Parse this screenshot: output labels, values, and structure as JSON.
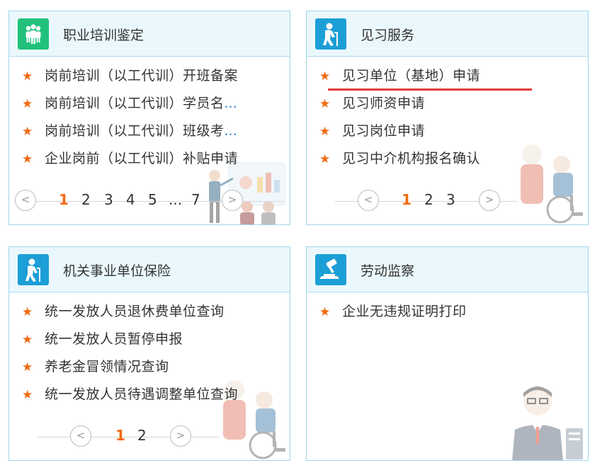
{
  "cards": [
    {
      "title": "职业培训鉴定",
      "icon": "people-group-icon",
      "items": [
        {
          "text": "岗前培训（以工代训）开班备案",
          "more": ""
        },
        {
          "text": "岗前培训（以工代训）学员名",
          "more": "..."
        },
        {
          "text": "岗前培训（以工代训）班级考",
          "more": "..."
        },
        {
          "text": "企业岗前（以工代训）补贴申请",
          "more": ""
        }
      ],
      "pagination": {
        "prev": "<",
        "pages": [
          "1",
          "2",
          "3",
          "4",
          "5",
          "...",
          "7"
        ],
        "current": "1",
        "next": ">"
      }
    },
    {
      "title": "见习服务",
      "icon": "elderly-person-icon",
      "items": [
        {
          "text": "见习单位（基地）申请",
          "more": ""
        },
        {
          "text": "见习师资申请",
          "more": ""
        },
        {
          "text": "见习岗位申请",
          "more": ""
        },
        {
          "text": "见习中介机构报名确认",
          "more": ""
        }
      ],
      "pagination": {
        "prev": "<",
        "pages": [
          "1",
          "2",
          "3"
        ],
        "current": "1",
        "next": ">"
      }
    },
    {
      "title": "机关事业单位保险",
      "icon": "elderly-person-icon",
      "items": [
        {
          "text": "统一发放人员退休费单位查询",
          "more": ""
        },
        {
          "text": "统一发放人员暂停申报",
          "more": ""
        },
        {
          "text": "养老金冒领情况查询",
          "more": ""
        },
        {
          "text": "统一发放人员待遇调整单位查询",
          "more": ""
        }
      ],
      "pagination": {
        "prev": "<",
        "pages": [
          "1",
          "2"
        ],
        "current": "1",
        "next": ">"
      }
    },
    {
      "title": "劳动监察",
      "icon": "gavel-icon",
      "items": [
        {
          "text": "企业无违规证明打印",
          "more": ""
        }
      ]
    }
  ],
  "colors": {
    "accent": "#f06a0f",
    "header_bg": "#eaf8fd",
    "border": "#9fd6ea",
    "icon_green": "#21c17c",
    "icon_blue": "#1c9ed6",
    "link_blue": "#2a7bd6",
    "highlight_red": "#e63b3b"
  }
}
